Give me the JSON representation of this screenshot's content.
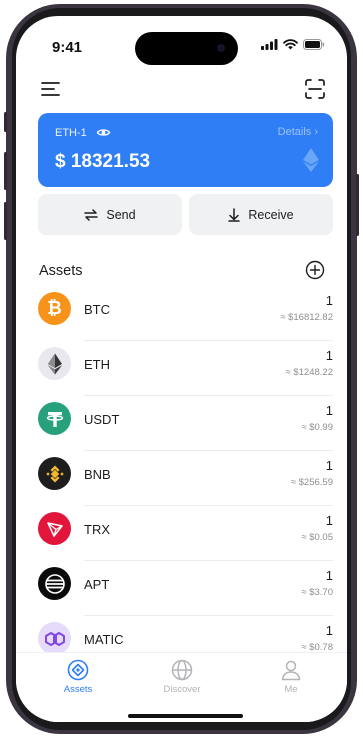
{
  "status_bar": {
    "time": "9:41"
  },
  "wallet": {
    "name": "ETH-1",
    "details_label": "Details",
    "balance": "$ 18321.53"
  },
  "actions": {
    "send_label": "Send",
    "receive_label": "Receive"
  },
  "assets": {
    "title": "Assets",
    "items": [
      {
        "symbol": "BTC",
        "amount": "1",
        "value": "≈ $16812.82",
        "color": "#f7931a",
        "icon": "bitcoin-icon"
      },
      {
        "symbol": "ETH",
        "amount": "1",
        "value": "≈ $1248.22",
        "color": "#e8e8ee",
        "icon": "ethereum-icon"
      },
      {
        "symbol": "USDT",
        "amount": "1",
        "value": "≈ $0.99",
        "color": "#26a17b",
        "icon": "tether-icon"
      },
      {
        "symbol": "BNB",
        "amount": "1",
        "value": "≈ $256.59",
        "color": "#1e1e1e",
        "icon": "bnb-icon"
      },
      {
        "symbol": "TRX",
        "amount": "1",
        "value": "≈ $0.05",
        "color": "#e2163b",
        "icon": "tron-icon"
      },
      {
        "symbol": "APT",
        "amount": "1",
        "value": "≈ $3.70",
        "color": "#0a0a0a",
        "icon": "aptos-icon"
      },
      {
        "symbol": "MATIC",
        "amount": "1",
        "value": "≈ $0.78",
        "color": "#e6dbfb",
        "icon": "polygon-icon"
      }
    ]
  },
  "tabs": [
    {
      "label": "Assets",
      "active": true
    },
    {
      "label": "Discover",
      "active": false
    },
    {
      "label": "Me",
      "active": false
    }
  ],
  "colors": {
    "accent": "#2f7ef6",
    "inactive_tab": "#b3b3b8",
    "button_bg": "#f0f1f3"
  }
}
